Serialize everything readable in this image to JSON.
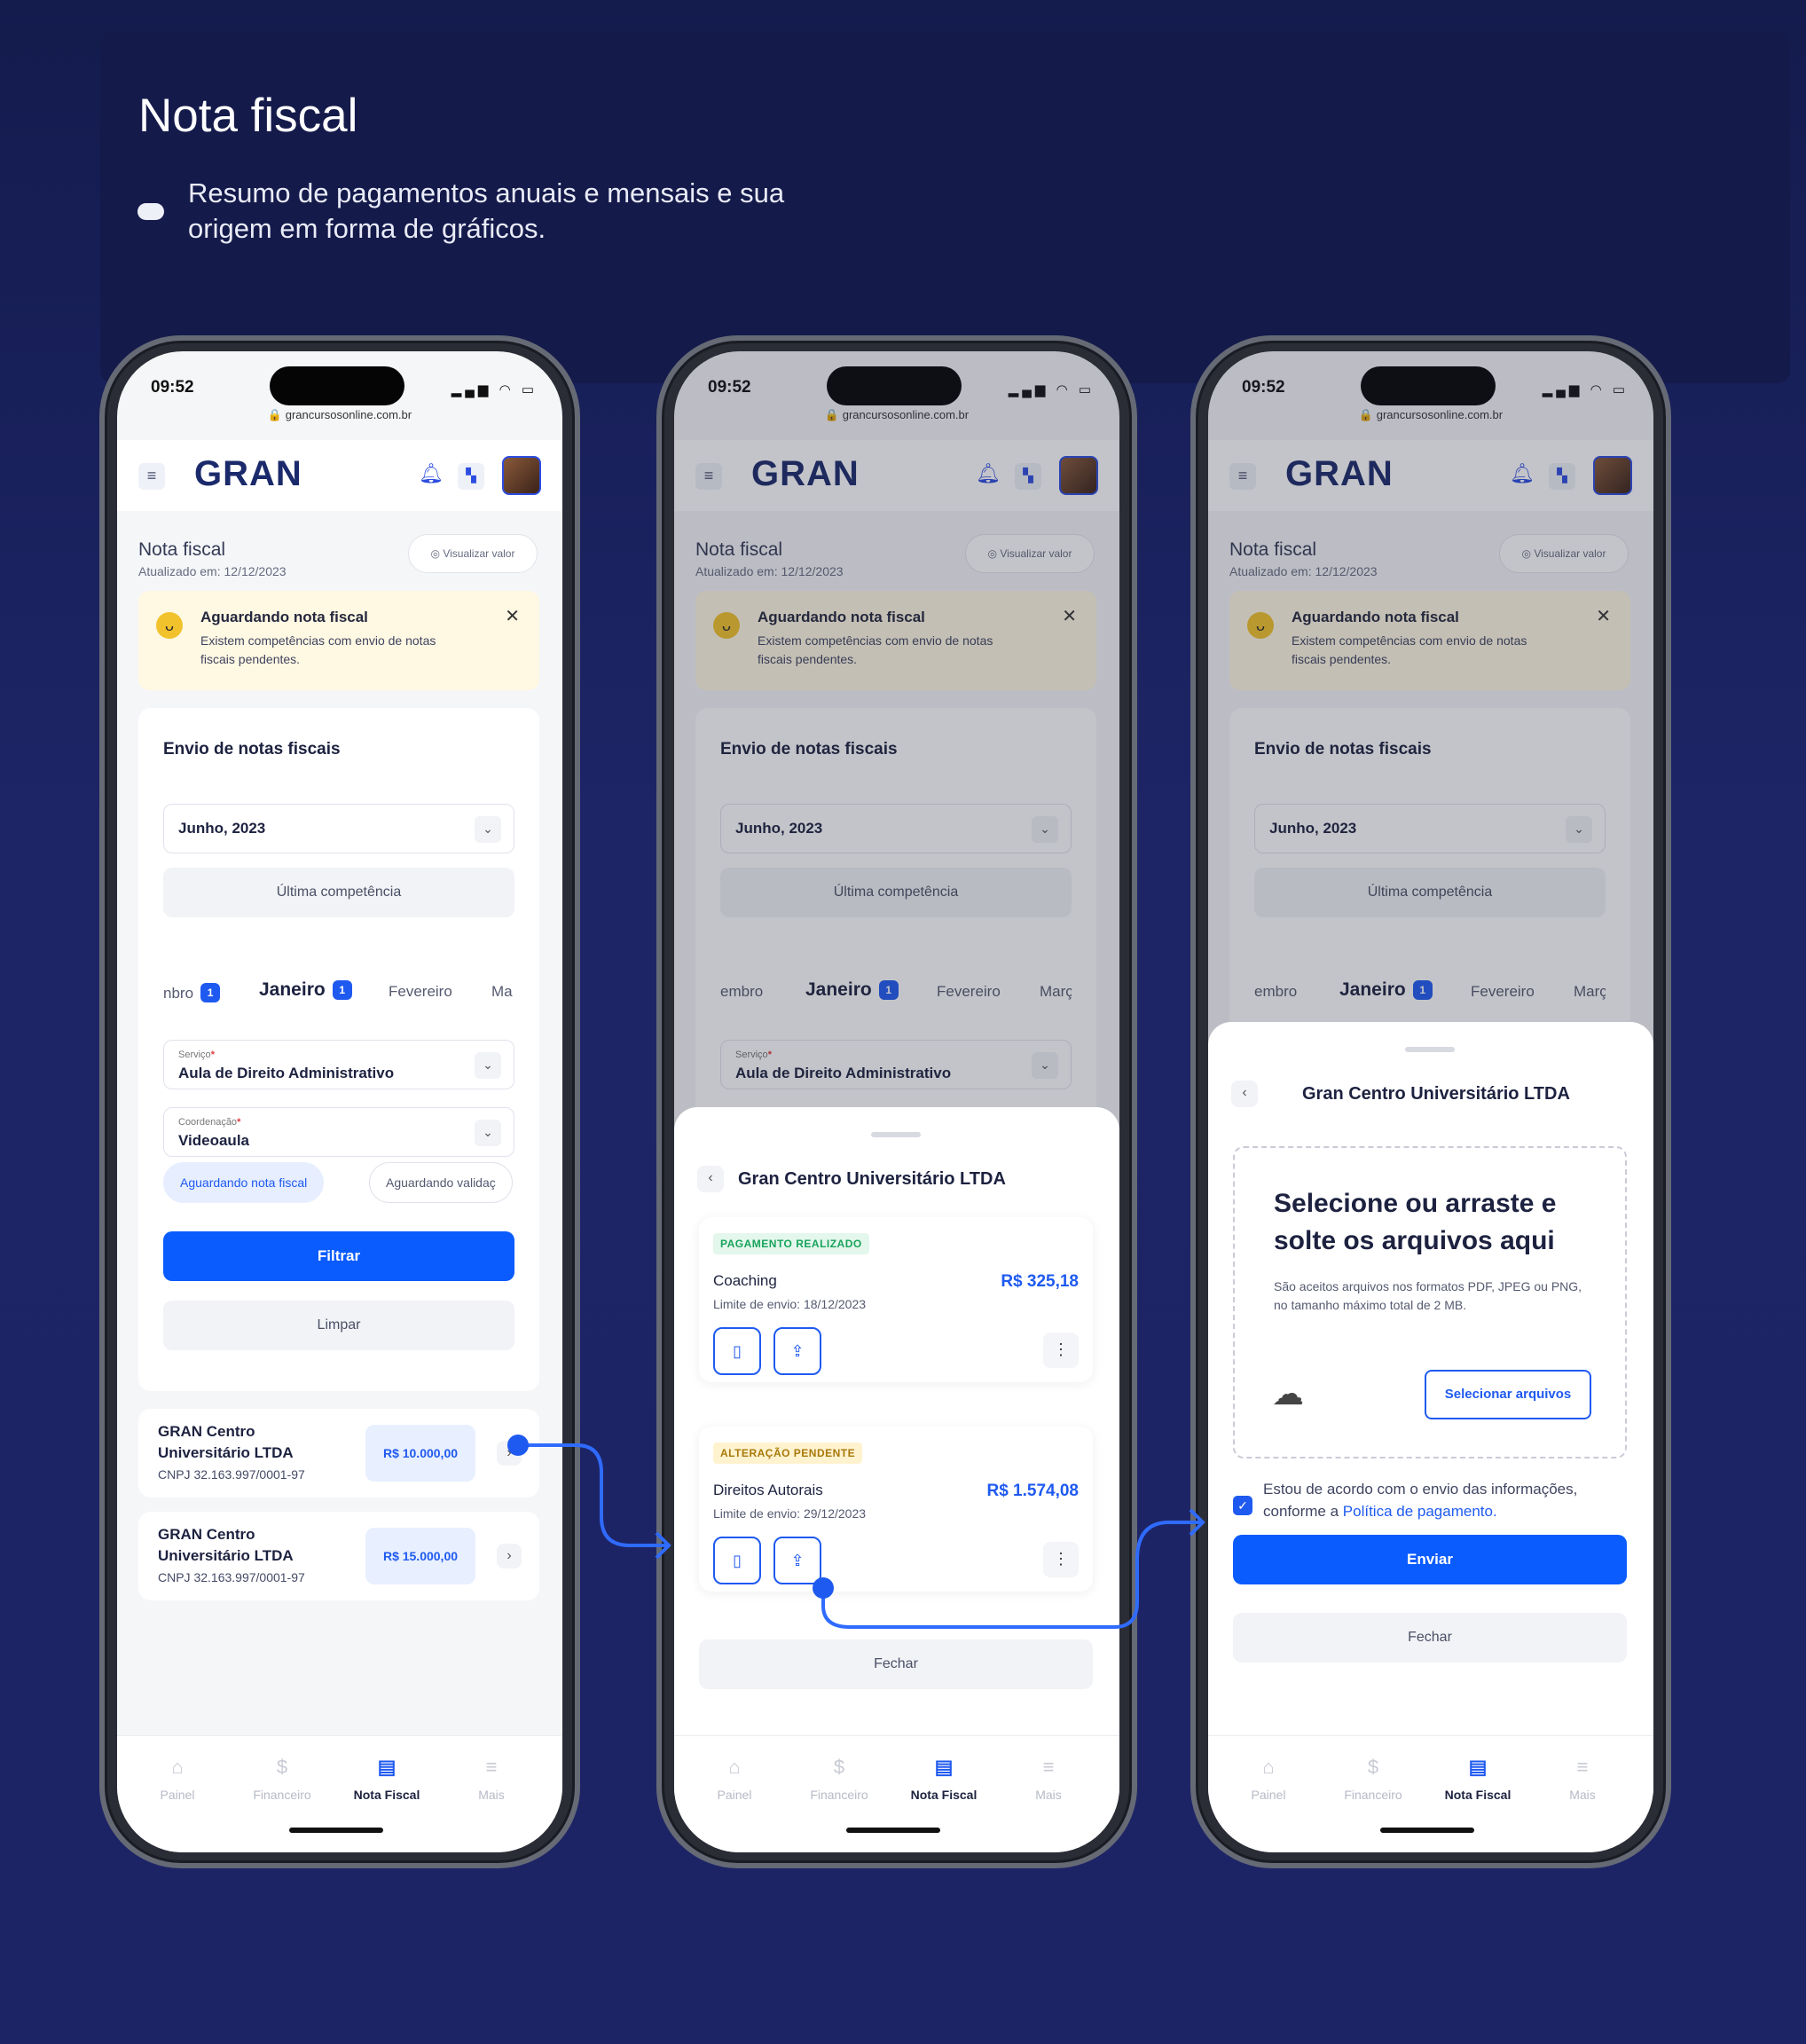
{
  "hero": {
    "title": "Nota fiscal",
    "description": "Resumo de pagamentos anuais e mensais e sua origem em forma de gráficos."
  },
  "device": {
    "time": "09:52",
    "url": "grancursosonline.com.br"
  },
  "appbar": {
    "logo": "GRAN"
  },
  "page": {
    "title": "Nota fiscal",
    "updated": "Atualizado em: 12/12/2023",
    "view_value": "Visualizar valor"
  },
  "alert": {
    "title": "Aguardando nota fiscal",
    "body": "Existem competências com envio de notas fiscais pendentes."
  },
  "card": {
    "title": "Envio de notas fiscais",
    "month_select": "Junho, 2023",
    "last_competence": "Última competência",
    "months": [
      {
        "label": "embro",
        "badge": "1"
      },
      {
        "label": "Janeiro",
        "badge": "1"
      },
      {
        "label": "Fevereiro",
        "badge": ""
      },
      {
        "label": "Març",
        "badge": ""
      }
    ],
    "months_phone1": [
      {
        "label": "nbro",
        "badge": "1"
      },
      {
        "label": "Janeiro",
        "badge": "1"
      },
      {
        "label": "Fevereiro",
        "badge": ""
      },
      {
        "label": "Ma",
        "badge": ""
      }
    ],
    "service_label": "Serviço",
    "service_value": "Aula de Direito Administrativo",
    "coord_label": "Coordenação",
    "coord_value": "Videoaula",
    "chip_active": "Aguardando nota fiscal",
    "chip_inactive": "Aguardando validaç",
    "filter_btn": "Filtrar",
    "clear_btn": "Limpar"
  },
  "results": [
    {
      "name": "GRAN Centro Universitário LTDA",
      "cnpj": "CNPJ 32.163.997/0001-97",
      "amount": "R$ 10.000,00"
    },
    {
      "name": "GRAN Centro Universitário LTDA",
      "cnpj": "CNPJ 32.163.997/0001-97",
      "amount": "R$ 15.000,00"
    }
  ],
  "nav": {
    "items": [
      "Painel",
      "Financeiro",
      "Nota Fiscal",
      "Mais"
    ]
  },
  "sheet2": {
    "title": "Gran Centro Universitário LTDA",
    "payments": [
      {
        "tag": "PAGAMENTO REALIZADO",
        "name": "Coaching",
        "limit": "Limite de envio: 18/12/2023",
        "amount": "R$ 325,18"
      },
      {
        "tag": "ALTERAÇÃO PENDENTE",
        "name": "Direitos Autorais",
        "limit": "Limite de envio: 29/12/2023",
        "amount": "R$ 1.574,08"
      }
    ],
    "close_btn": "Fechar"
  },
  "sheet3": {
    "title": "Gran Centro Universitário LTDA",
    "drop_title": "Selecione ou arraste e solte os arquivos aqui",
    "drop_body": "São aceitos arquivos nos formatos PDF, JPEG ou PNG, no tamanho máximo total de 2 MB.",
    "select_btn": "Selecionar arquivos",
    "consent_text": "Estou de acordo com o envio das informações, conforme a",
    "consent_link": "Política de pagamento",
    "consent_end": ".",
    "send_btn": "Enviar",
    "close_btn": "Fechar"
  },
  "colors": {
    "accent": "#0a5cff",
    "background": "#1c2466",
    "alert_bg": "#fff8e2"
  }
}
